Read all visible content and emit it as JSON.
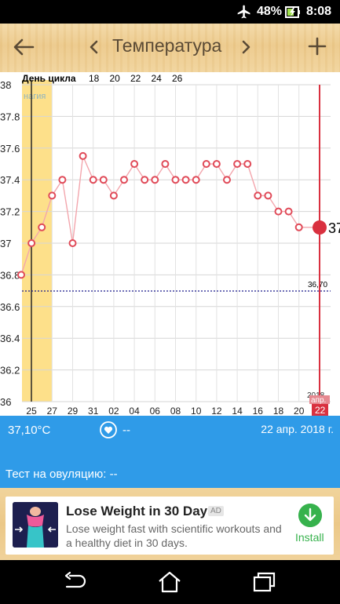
{
  "status_bar": {
    "battery_percent": "48%",
    "time": "8:08",
    "icons": [
      "airplane-mode-icon",
      "battery-charging-icon"
    ]
  },
  "toolbar": {
    "title": "Температура",
    "icons": {
      "back": "arrow-left-icon",
      "prev": "chevron-left-icon",
      "next": "chevron-right-icon",
      "add": "plus-icon"
    }
  },
  "chart": {
    "header_label": "День цикла",
    "phase_label": "нагия",
    "coverline_label": "36,70",
    "current_value_label": "37,",
    "year_label": "2018",
    "month_label": "апр.",
    "day_label": "22"
  },
  "chart_data": {
    "type": "line",
    "title": "",
    "ylim": [
      36.0,
      38.0
    ],
    "y_ticks": [
      "38",
      "37.8",
      "37.6",
      "37.4",
      "37.2",
      "37",
      "36.8",
      "36.6",
      "36.4",
      "36.2",
      "36"
    ],
    "y_tick_values": [
      38.0,
      37.8,
      37.6,
      37.4,
      37.2,
      37.0,
      36.8,
      36.6,
      36.4,
      36.2,
      36.0
    ],
    "cycle_day_labels": [
      "18",
      "20",
      "22",
      "24",
      "26"
    ],
    "date_labels": [
      "25",
      "27",
      "29",
      "31",
      "02",
      "04",
      "06",
      "08",
      "10",
      "12",
      "14",
      "16",
      "18",
      "20",
      "22"
    ],
    "dates": [
      "24",
      "25",
      "26",
      "27",
      "28",
      "29",
      "30",
      "31",
      "01",
      "02",
      "03",
      "04",
      "05",
      "06",
      "07",
      "08",
      "09",
      "10",
      "11",
      "12",
      "13",
      "14",
      "15",
      "16",
      "17",
      "18",
      "19",
      "20",
      "21",
      "22"
    ],
    "series": [
      {
        "values": [
          36.8,
          37.0,
          37.1,
          37.3,
          37.4,
          37.0,
          37.55,
          37.4,
          37.4,
          37.3,
          37.4,
          37.5,
          37.4,
          37.4,
          37.5,
          37.4,
          37.4,
          37.4,
          37.5,
          37.5,
          37.4,
          37.5,
          37.5,
          37.3,
          37.3,
          37.2,
          37.2,
          37.1
        ]
      }
    ],
    "coverline": 36.7,
    "current_value": 37.1,
    "grid": true,
    "colors": {
      "line": "#f3a6ad",
      "marker": "#e04a58",
      "phase_band": "#fde08a",
      "coverline": "#1a1a8c",
      "current": "#d9303f"
    }
  },
  "info": {
    "temperature": "37,10°C",
    "heart_value": "--",
    "date": "22 апр. 2018 г."
  },
  "ovulation": {
    "text": "Тест на овуляцию: --"
  },
  "ad": {
    "title": "Lose Weight in 30 Days",
    "badge": "AD",
    "body": "Lose weight fast with scientific workouts and a healthy diet in 30 days.",
    "install": "Install"
  }
}
